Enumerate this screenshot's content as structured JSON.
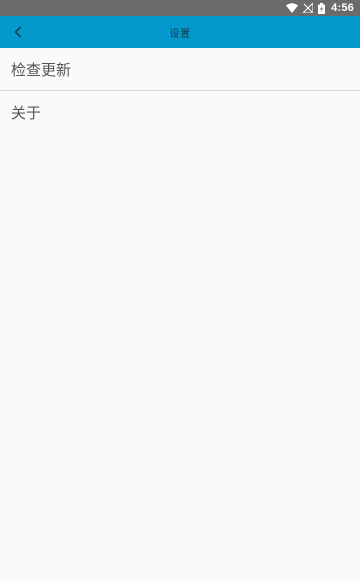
{
  "status_bar": {
    "time": "4:56",
    "icons": [
      "wifi-icon",
      "no-signal-icon",
      "battery-icon"
    ]
  },
  "app_bar": {
    "title": "设置",
    "back_icon": "chevron-left-icon"
  },
  "settings_list": {
    "items": [
      {
        "label": "检查更新"
      },
      {
        "label": "关于"
      }
    ]
  },
  "colors": {
    "status_bar": "#6b6b6b",
    "app_bar": "#0598cd",
    "background": "#fafafa",
    "divider": "#d6d6d6",
    "item_text": "#555555"
  }
}
